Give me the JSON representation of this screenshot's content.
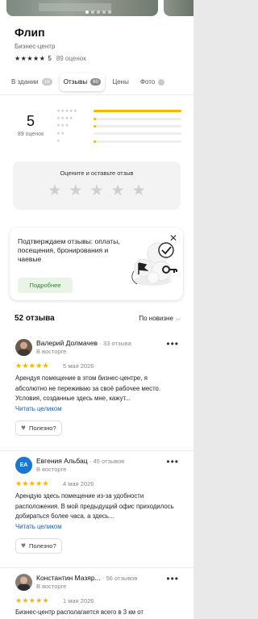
{
  "place": {
    "title": "Флип",
    "category": "Бизнес-центр",
    "rating": "5",
    "rating_count": "89 оценок",
    "stars": "★★★★★"
  },
  "tabs": [
    {
      "label": "В здании",
      "badge": "16"
    },
    {
      "label": "Отзывы",
      "badge": "60",
      "active": true
    },
    {
      "label": "Цены",
      "badge": ""
    },
    {
      "label": "Фото",
      "badge": ""
    }
  ],
  "summary": {
    "rating": "5",
    "rating_count": "89 оценок",
    "distribution_labels": [
      "★★★★★",
      "★★★★",
      "★★★",
      "★★",
      "★"
    ],
    "distribution_fractions": [
      1.0,
      0.03,
      0.02,
      0.0,
      0.02
    ]
  },
  "rate_prompt": {
    "label": "Оцените и оставьте отзыв",
    "stars": [
      "★",
      "★",
      "★",
      "★",
      "★"
    ]
  },
  "promo": {
    "text": "Подтверждаем отзывы: оплаты, посещения, бронирования и чаевые",
    "button": "Подробнее",
    "close": "✕"
  },
  "reviews_header": {
    "count": "52 отзыва",
    "sort": "По новизне",
    "sort_chevron": "⌵"
  },
  "reviews": [
    {
      "author": "Валерий Долмачев",
      "stats": "· 33 отзыва",
      "level": "В восторге",
      "stars": "★★★★★",
      "date": "5 мая 2026",
      "text": "Арендуя помещение в этом бизнес-центре, я абсолютно не переживаю за своё рабочее место. Условия, созданные здесь мне, кажут...",
      "link": "Читать целиком",
      "useful": "Полезно?",
      "more": "•••",
      "avatar": "photo"
    },
    {
      "author": "Евгения Альбац",
      "stats": "· 45 отзывов",
      "level": "В восторге",
      "stars": "★★★★★",
      "date": "4 мая 2026",
      "text": "Арендую здесь помещение из-за удобности расположения. В мой предыдущий офис приходилось добираться более часа, а здесь...",
      "link": "Читать целиком",
      "useful": "Полезно?",
      "more": "•••",
      "avatar": "ЕА",
      "avatar_color": "#1976d2"
    },
    {
      "author": "Константин Мазяр...",
      "stats": "· 56 отзывов",
      "level": "В восторге",
      "stars": "★★★★★",
      "date": "1 мая 2026",
      "text": "Бизнес-центр располагается всего в 3 км от",
      "more": "•••",
      "avatar": "photo"
    }
  ],
  "colors": {
    "accent_star": "#f5b800",
    "link": "#1a5fb4",
    "promo_button_text": "#2a8a2a"
  }
}
